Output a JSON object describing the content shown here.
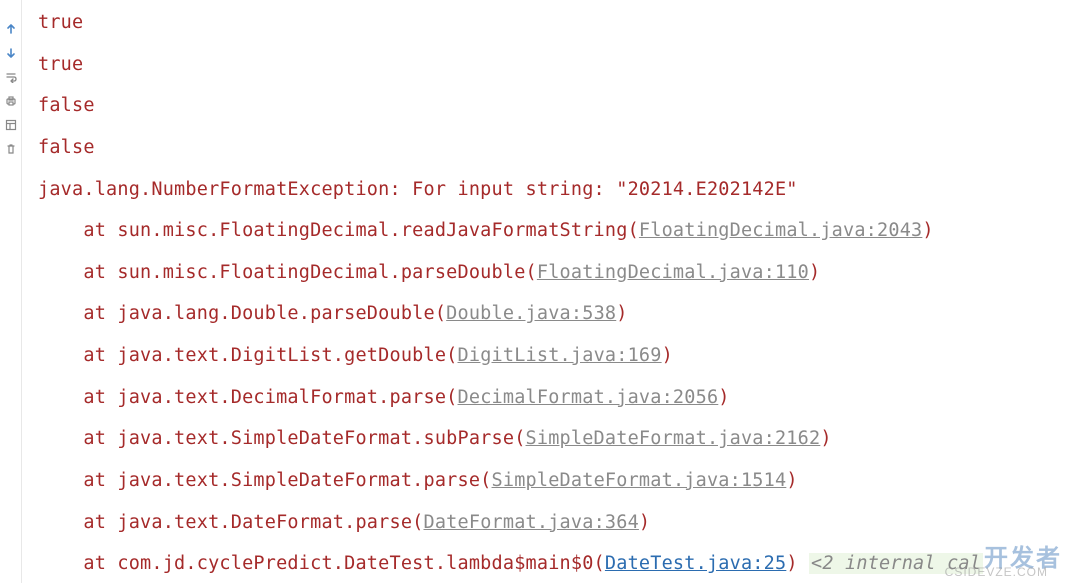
{
  "output": {
    "line1": "true",
    "line2": "true",
    "line3": "false",
    "line4": "false"
  },
  "exception": {
    "header": "java.lang.NumberFormatException: For input string: \"20214.E202142E\"",
    "stack": [
      {
        "prefix": "    at sun.misc.FloatingDecimal.readJavaFormatString(",
        "link": "FloatingDecimal.java:2043",
        "suffix": ")"
      },
      {
        "prefix": "    at sun.misc.FloatingDecimal.parseDouble(",
        "link": "FloatingDecimal.java:110",
        "suffix": ")"
      },
      {
        "prefix": "    at java.lang.Double.parseDouble(",
        "link": "Double.java:538",
        "suffix": ")"
      },
      {
        "prefix": "    at java.text.DigitList.getDouble(",
        "link": "DigitList.java:169",
        "suffix": ")"
      },
      {
        "prefix": "    at java.text.DecimalFormat.parse(",
        "link": "DecimalFormat.java:2056",
        "suffix": ")"
      },
      {
        "prefix": "    at java.text.SimpleDateFormat.subParse(",
        "link": "SimpleDateFormat.java:2162",
        "suffix": ")"
      },
      {
        "prefix": "    at java.text.SimpleDateFormat.parse(",
        "link": "SimpleDateFormat.java:1514",
        "suffix": ")"
      },
      {
        "prefix": "    at java.text.DateFormat.parse(",
        "link": "DateFormat.java:364",
        "suffix": ")"
      }
    ],
    "lastline": {
      "prefix": "    at com.jd.cyclePredict.DateTest.lambda$main$0(",
      "link": "DateTest.java:25",
      "suffix": ") ",
      "hint": "<2 internal cal"
    }
  },
  "watermark": {
    "main": "开发者",
    "sub": "CSIDEVZE.COM"
  },
  "gutter": {
    "icons": [
      "arrow-up",
      "arrow-down",
      "wrap",
      "print",
      "layout",
      "trash"
    ]
  }
}
